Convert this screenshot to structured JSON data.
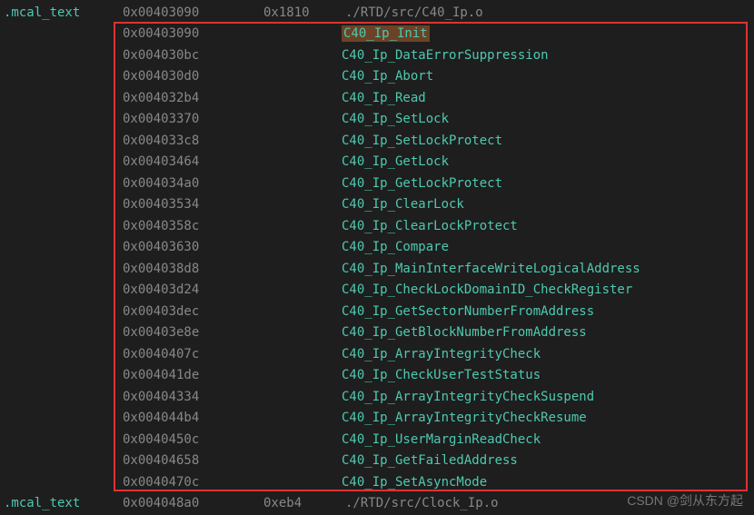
{
  "header": {
    "section": ".mcal_text",
    "addr": "0x00403090",
    "size": "0x1810",
    "path": "./RTD/src/C40_Ip.o"
  },
  "symbols": [
    {
      "addr": "0x00403090",
      "name": "C40_Ip_Init",
      "highlighted": true
    },
    {
      "addr": "0x004030bc",
      "name": "C40_Ip_DataErrorSuppression"
    },
    {
      "addr": "0x004030d0",
      "name": "C40_Ip_Abort"
    },
    {
      "addr": "0x004032b4",
      "name": "C40_Ip_Read"
    },
    {
      "addr": "0x00403370",
      "name": "C40_Ip_SetLock"
    },
    {
      "addr": "0x004033c8",
      "name": "C40_Ip_SetLockProtect"
    },
    {
      "addr": "0x00403464",
      "name": "C40_Ip_GetLock"
    },
    {
      "addr": "0x004034a0",
      "name": "C40_Ip_GetLockProtect"
    },
    {
      "addr": "0x00403534",
      "name": "C40_Ip_ClearLock"
    },
    {
      "addr": "0x0040358c",
      "name": "C40_Ip_ClearLockProtect"
    },
    {
      "addr": "0x00403630",
      "name": "C40_Ip_Compare"
    },
    {
      "addr": "0x004038d8",
      "name": "C40_Ip_MainInterfaceWriteLogicalAddress"
    },
    {
      "addr": "0x00403d24",
      "name": "C40_Ip_CheckLockDomainID_CheckRegister"
    },
    {
      "addr": "0x00403dec",
      "name": "C40_Ip_GetSectorNumberFromAddress"
    },
    {
      "addr": "0x00403e8e",
      "name": "C40_Ip_GetBlockNumberFromAddress"
    },
    {
      "addr": "0x0040407c",
      "name": "C40_Ip_ArrayIntegrityCheck"
    },
    {
      "addr": "0x004041de",
      "name": "C40_Ip_CheckUserTestStatus"
    },
    {
      "addr": "0x00404334",
      "name": "C40_Ip_ArrayIntegrityCheckSuspend"
    },
    {
      "addr": "0x004044b4",
      "name": "C40_Ip_ArrayIntegrityCheckResume"
    },
    {
      "addr": "0x0040450c",
      "name": "C40_Ip_UserMarginReadCheck"
    },
    {
      "addr": "0x00404658",
      "name": "C40_Ip_GetFailedAddress"
    },
    {
      "addr": "0x0040470c",
      "name": "C40_Ip_SetAsyncMode"
    }
  ],
  "footer": {
    "section": ".mcal_text",
    "addr": "0x004048a0",
    "size": "0xeb4",
    "path": "./RTD/src/Clock_Ip.o"
  },
  "watermark": "CSDN @剑从东方起"
}
